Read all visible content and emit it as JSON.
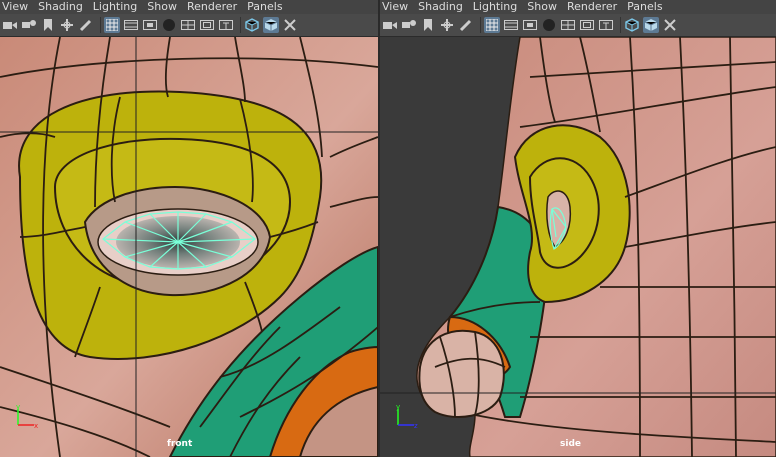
{
  "panels": [
    {
      "id": "front",
      "menu": [
        "View",
        "Shading",
        "Lighting",
        "Show",
        "Renderer",
        "Panels"
      ],
      "camera_label": "front"
    },
    {
      "id": "side",
      "menu": [
        "View",
        "Shading",
        "Lighting",
        "Show",
        "Renderer",
        "Panels"
      ],
      "camera_label": "side"
    }
  ],
  "toolbar_icons": [
    "camera-icon",
    "camera-attr-icon",
    "bookmark-icon",
    "pan-icon",
    "grease-pencil-icon",
    "grid-icon",
    "film-gate-icon",
    "resolution-gate-icon",
    "gate-mask-icon",
    "field-chart-icon",
    "safe-action-icon",
    "safe-title-icon",
    "wireframe-icon",
    "smooth-shade-icon",
    "isolate-icon"
  ],
  "colors": {
    "skin": "#d49b8e",
    "yellow": "#bdb20c",
    "teal": "#1f9e76",
    "orange": "#d86a12",
    "wire": "#2b1d12",
    "selection": "#7affd8",
    "bg": "#3a3a3a"
  }
}
